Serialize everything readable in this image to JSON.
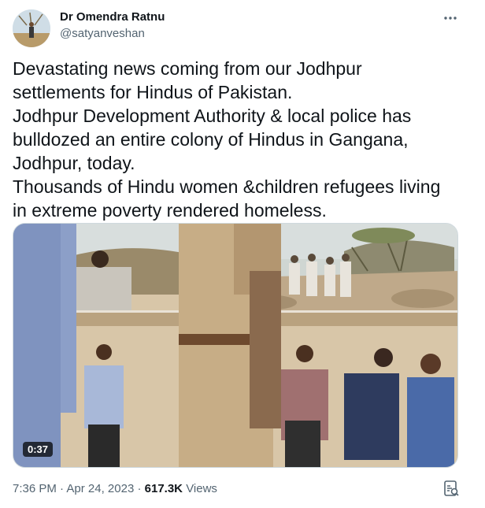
{
  "author": {
    "name": "Dr Omendra Ratnu",
    "handle": "@satyanveshan",
    "avatar_icon": "profile-photo"
  },
  "more_icon": "more-horizontal-icon",
  "tweet_lines": [
    "Devastating news coming from our Jodhpur",
    "settlements for Hindus of Pakistan.",
    "Jodhpur Development Authority & local police has",
    "bulldozed an entire colony of Hindus in Gangana,",
    "Jodhpur, today.",
    "Thousands of Hindu women &children refugees living",
    "in extreme poverty rendered homeless."
  ],
  "video": {
    "duration": "0:37"
  },
  "meta": {
    "time": "7:36 PM",
    "separator": "·",
    "date": "Apr 24, 2023",
    "views_count": "617.3K",
    "views_label": "Views"
  },
  "analytics_icon": "analytics-icon",
  "colors": {
    "text_primary": "#0f1419",
    "text_secondary": "#536471",
    "border": "#cfd9de"
  }
}
